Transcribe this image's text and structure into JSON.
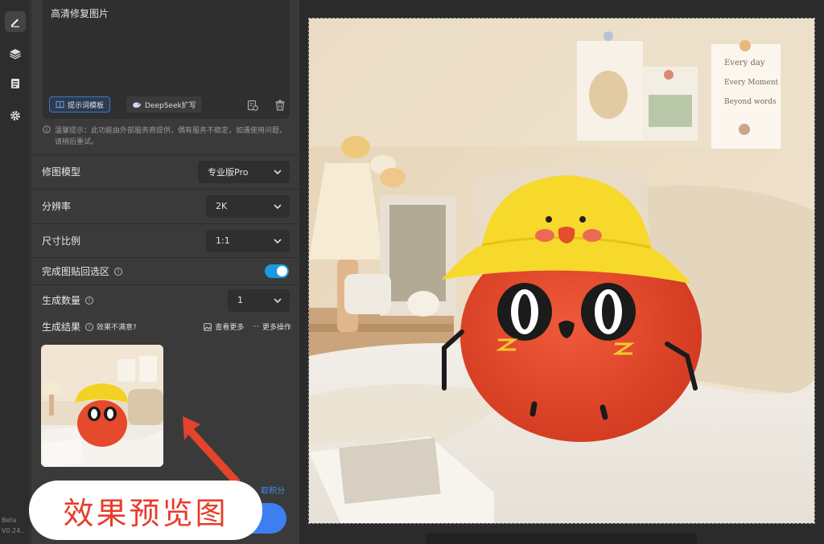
{
  "rail": {
    "tools": [
      {
        "name": "edit-icon",
        "active": true
      },
      {
        "name": "layers-icon",
        "active": false
      },
      {
        "name": "document-icon",
        "active": false
      },
      {
        "name": "gear-icon",
        "active": false
      }
    ],
    "version_line1": "Beta",
    "version_line2": "V0.24.."
  },
  "prompt": {
    "text": "高清修复图片",
    "template_chip": "提示词模板",
    "deepseek_chip": "DeepSeek扩写"
  },
  "tip": "温馨提示：此功能由外部服务商提供，偶有服务不稳定，如遇使用问题，请稍后重试。",
  "settings": {
    "model_label": "修图模型",
    "model_value": "专业版Pro",
    "resolution_label": "分辨率",
    "resolution_value": "2K",
    "ratio_label": "尺寸比例",
    "ratio_value": "1:1",
    "paste_label": "完成图贴回选区",
    "paste_enabled": true,
    "count_label": "生成数量",
    "count_value": "1"
  },
  "results": {
    "label": "生成结果",
    "unsatisfied": "效果不满意?",
    "view_more": "查看更多",
    "more_actions": "更多操作"
  },
  "credit_link": "取积分",
  "overlay_label": "效果预览图",
  "canvas_image": {
    "text_lines": [
      "Every day",
      "Every Moment",
      "Beyond words"
    ]
  },
  "colors": {
    "accent": "#3d7ff0",
    "toggle": "#1a9ae0",
    "overlay_text": "#e83c2a"
  }
}
